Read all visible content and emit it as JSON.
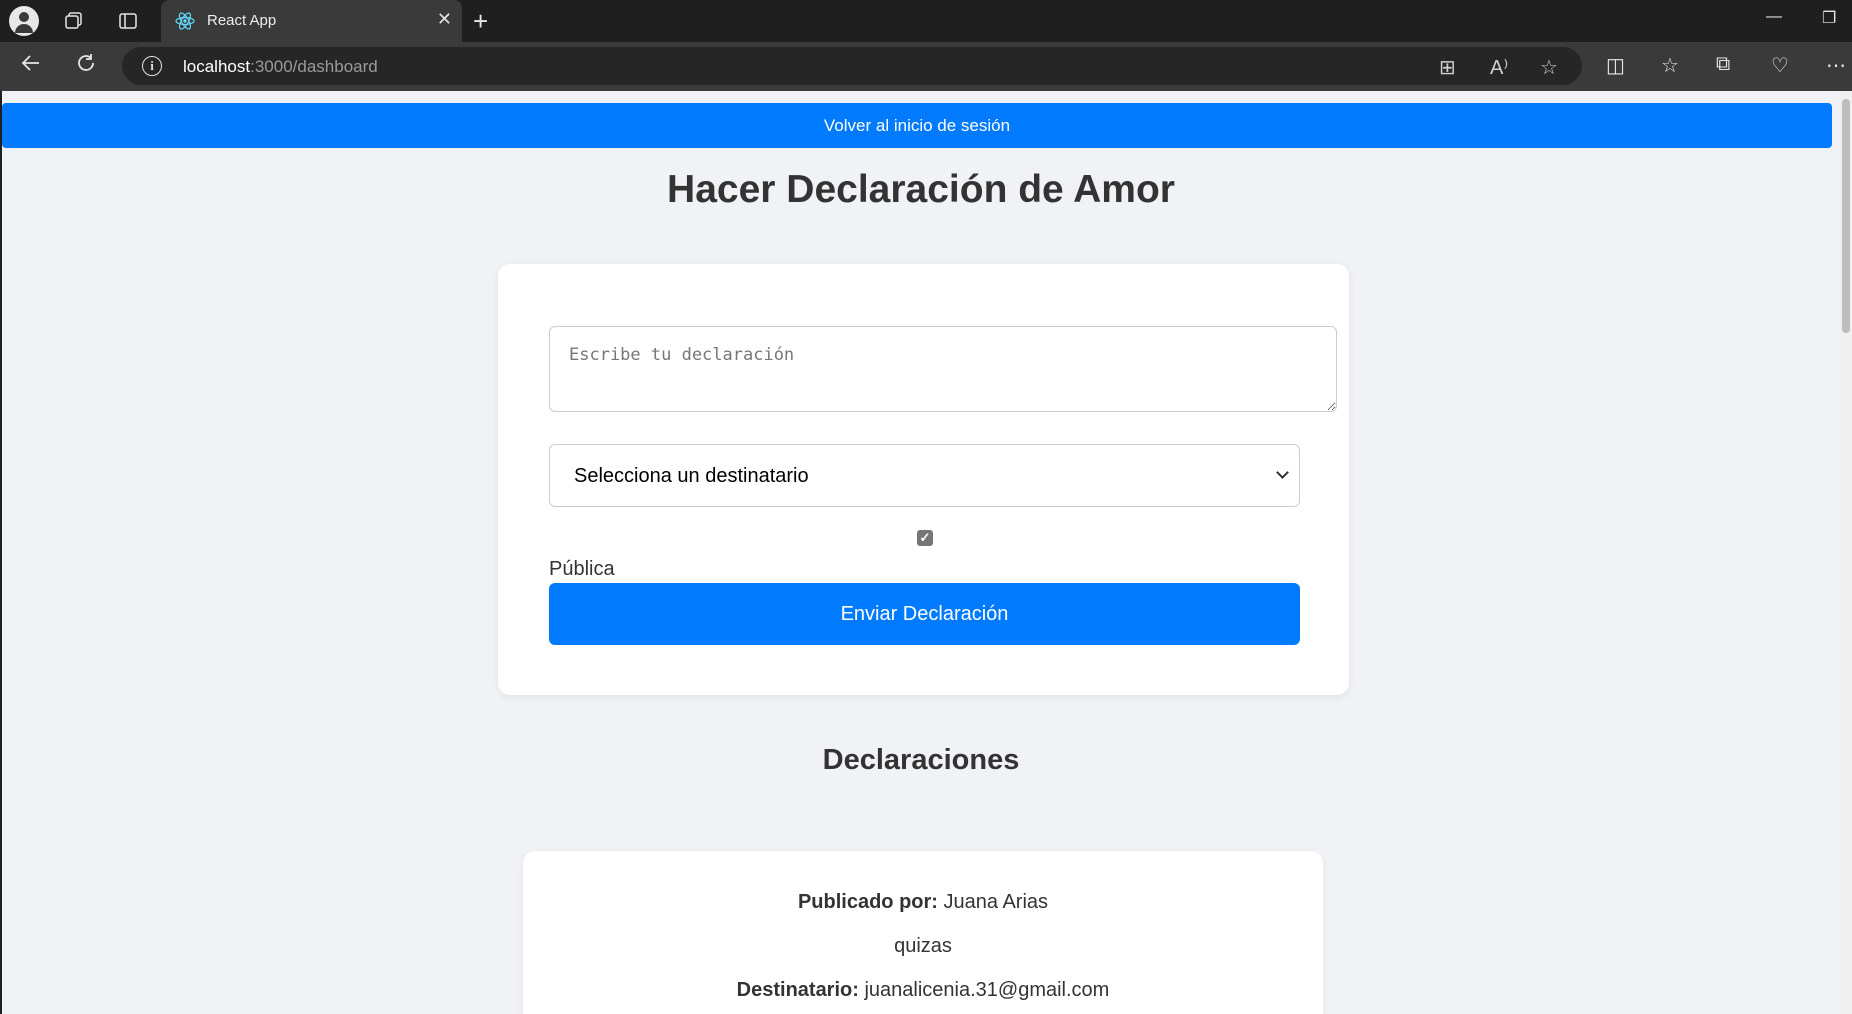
{
  "browser": {
    "tab_title": "React App",
    "url_host": "localhost",
    "url_rest": ":3000/dashboard"
  },
  "page": {
    "back_button": "Volver al inicio de sesión",
    "title": "Hacer Declaración de Amor",
    "form": {
      "textarea_placeholder": "Escribe tu declaración",
      "select_value": "Selecciona un destinatario",
      "checkbox_checked": true,
      "checkbox_label": "Pública",
      "submit_label": "Enviar Declaración"
    },
    "section_title": "Declaraciones",
    "posts": [
      {
        "author_label": "Publicado por:",
        "author": "Juana Arias",
        "message": "quizas",
        "recipient_label": "Destinatario:",
        "recipient": "juanalicenia.31@gmail.com"
      }
    ]
  },
  "colors": {
    "primary": "#007bff",
    "background": "#f0f2f5"
  }
}
